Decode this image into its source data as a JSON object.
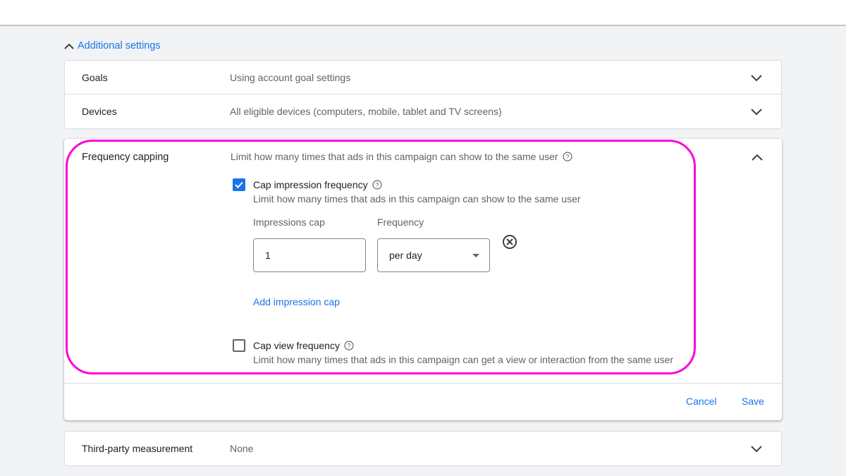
{
  "section_toggle": {
    "label": "Additional settings",
    "expanded": true
  },
  "settings_rows": [
    {
      "label": "Goals",
      "value": "Using account goal settings"
    },
    {
      "label": "Devices",
      "value": "All eligible devices (computers, mobile, tablet and TV screens)"
    }
  ],
  "frequency_capping": {
    "title": "Frequency capping",
    "description": "Limit how many times that ads in this campaign can show to the same user",
    "cap_impression": {
      "label": "Cap impression frequency",
      "checked": true,
      "description": "Limit how many times that ads in this campaign can show to the same user"
    },
    "impressions_cap_label": "Impressions cap",
    "impressions_cap_value": "1",
    "frequency_label": "Frequency",
    "frequency_value": "per day",
    "add_impression_cap": "Add impression cap",
    "cap_view": {
      "label": "Cap view frequency",
      "checked": false,
      "description": "Limit how many times that ads in this campaign can get a view or interaction from the same user"
    },
    "cancel_label": "Cancel",
    "save_label": "Save"
  },
  "third_party": {
    "label": "Third-party measurement",
    "value": "None"
  },
  "colors": {
    "accent": "#1a73e8",
    "highlight": "#ff00d8",
    "background": "#f1f3f4"
  }
}
